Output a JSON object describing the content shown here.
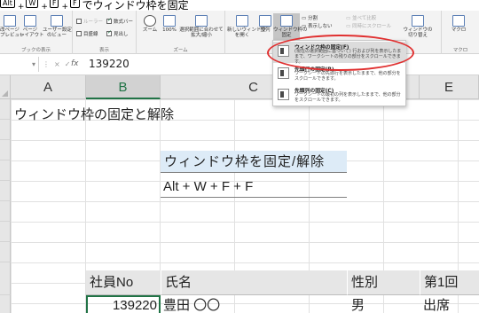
{
  "caption": {
    "keys": [
      "Alt",
      "W",
      "F",
      "F"
    ],
    "text": "でウィンドウ枠を固定"
  },
  "ribbon": {
    "view_group": {
      "buttons": [
        "改ページ\nプレビュー",
        "ページ\nレイアウト",
        "ユーザー設定\nのビュー"
      ],
      "label": "ブックの表示"
    },
    "show_group": {
      "items": [
        {
          "label": "ルーラー",
          "checked": false,
          "dim": true
        },
        {
          "label": "数式バー",
          "checked": true,
          "dim": false
        },
        {
          "label": "目盛線",
          "checked": false,
          "dim": false
        },
        {
          "label": "見出し",
          "checked": true,
          "dim": false
        }
      ],
      "label": "表示"
    },
    "zoom_group": {
      "buttons": [
        "ズーム",
        "100%",
        "選択範囲に合わせて\n拡大/縮小"
      ],
      "label": "ズーム"
    },
    "window_group": {
      "buttons": [
        "新しいウィンドウ\nを開く",
        "整列",
        "ウィンドウ枠の\n固定"
      ],
      "small_items": [
        {
          "label": "分割",
          "dim": false
        },
        {
          "label": "表示しない",
          "dim": false
        },
        {
          "label": "並べて比較",
          "dim": true
        },
        {
          "label": "同時にスクロール",
          "dim": true
        }
      ],
      "switch_button": "ウィンドウの\n切り替え"
    },
    "macro_group": {
      "button": "マクロ",
      "label": "マクロ"
    }
  },
  "dropdown": {
    "items": [
      {
        "title": "ウィンドウ枠の固定(F)",
        "desc": "(現在の選択範囲に基づいて) 行および列を表示したままで、ワークシートの残りの部分をスクロールできます。"
      },
      {
        "title": "先頭行の固定(R)",
        "desc": "ワークシートの先頭行を表示したままで、他の部分をスクロールできます。"
      },
      {
        "title": "先頭列の固定(C)",
        "desc": "ワークシートの最初の列を表示したままで、他の部分をスクロールできます。"
      }
    ]
  },
  "formula_bar": {
    "namebox": "",
    "value": "139220",
    "fx": "fx"
  },
  "columns": [
    "A",
    "B",
    "C",
    "D",
    "E"
  ],
  "selected_column": "B",
  "sheet": {
    "heading": "ウィンドウ枠の固定と解除",
    "shortcut_title": "ウィンドウ枠を固定/解除",
    "shortcut_keys": "Alt + W + F + F",
    "table_headers": [
      "社員No",
      "氏名",
      "性別",
      "第1回"
    ],
    "row1": [
      "139220",
      "豊田 〇〇",
      "男",
      "出席"
    ]
  },
  "colors": {
    "accent": "#217346",
    "highlight": "#e03030",
    "title_fill": "#ddebf7"
  }
}
